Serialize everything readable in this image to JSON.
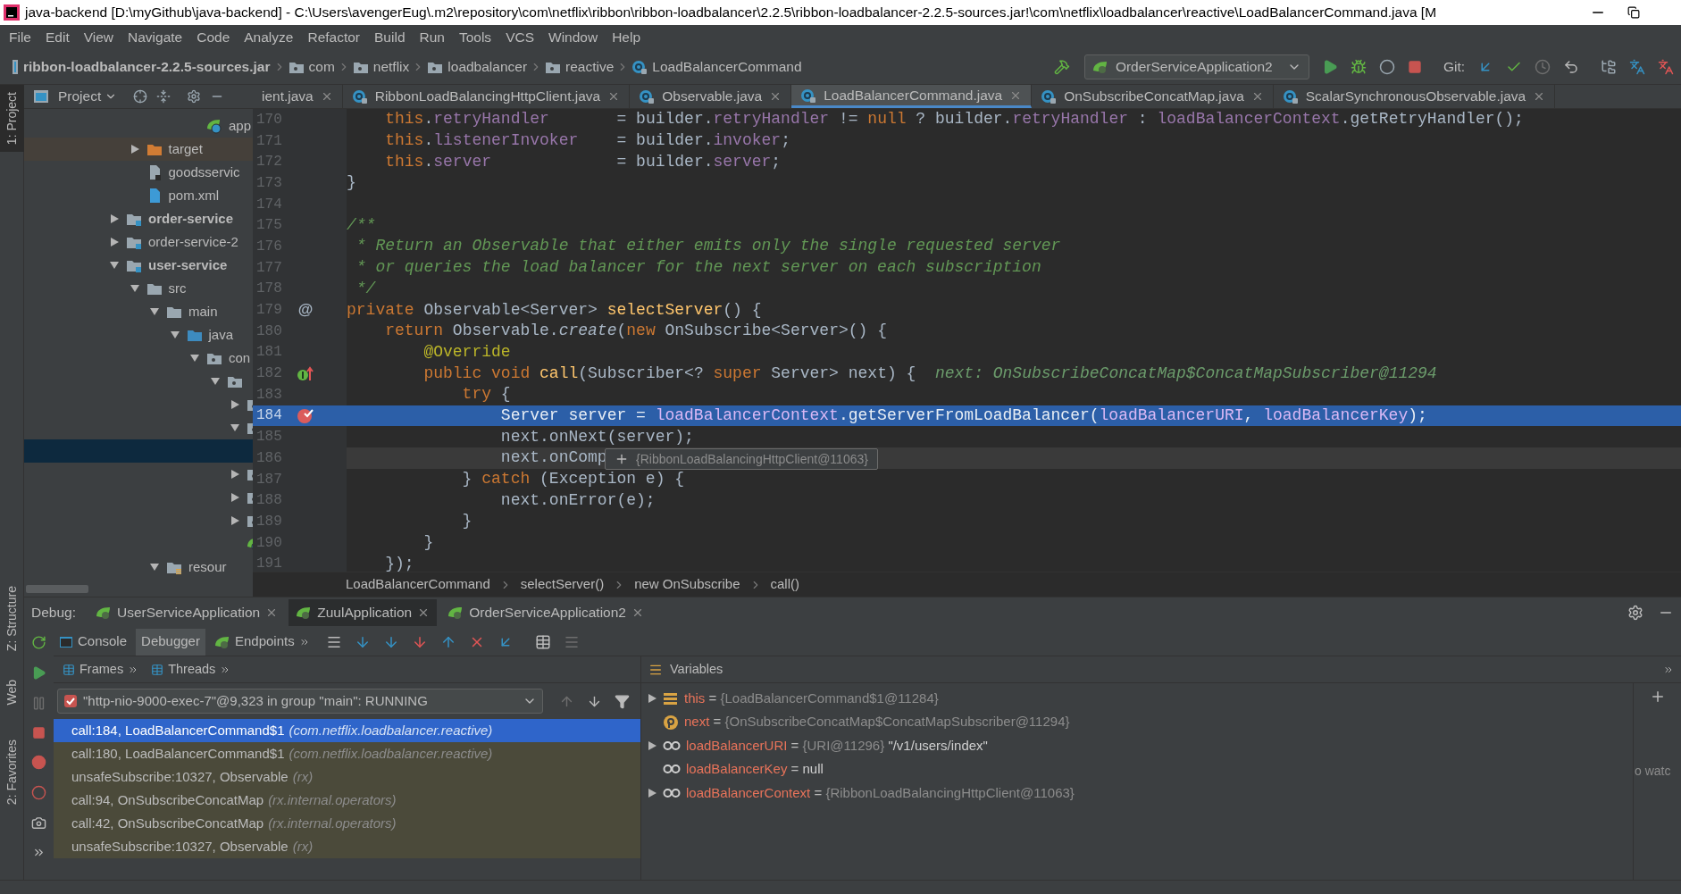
{
  "window": {
    "title": "java-backend [D:\\myGithub\\java-backend] - C:\\Users\\avengerEug\\.m2\\repository\\com\\netflix\\ribbon\\ribbon-loadbalancer\\2.2.5\\ribbon-loadbalancer-2.2.5-sources.jar!\\com\\netflix\\loadbalancer\\reactive\\LoadBalancerCommand.java [M"
  },
  "menu": [
    "File",
    "Edit",
    "View",
    "Navigate",
    "Code",
    "Analyze",
    "Refactor",
    "Build",
    "Run",
    "Tools",
    "VCS",
    "Window",
    "Help"
  ],
  "nav_bar": {
    "crumbs": [
      {
        "label": "ribbon-loadbalancer-2.2.5-sources.jar",
        "kind": "jar"
      },
      {
        "label": "com",
        "kind": "package"
      },
      {
        "label": "netflix",
        "kind": "package"
      },
      {
        "label": "loadbalancer",
        "kind": "package"
      },
      {
        "label": "reactive",
        "kind": "package"
      },
      {
        "label": "LoadBalancerCommand",
        "kind": "class"
      }
    ],
    "run_config": "OrderServiceApplication2",
    "git_label": "Git:"
  },
  "tool_strip": [
    {
      "label": "1: Project",
      "selected": true
    },
    {
      "label": "Z: Structure",
      "selected": false
    },
    {
      "label": "Web",
      "selected": false
    },
    {
      "label": "2: Favorites",
      "selected": false
    }
  ],
  "project_panel": {
    "title": "Project",
    "tree": [
      {
        "children": [
          {
            "children": [
              {
                "children": [
                  {
                    "children": [
                      {
                        "label": "app",
                        "kind": "spring",
                        "selected": false
                      }
                    ]
                  }
                ]
              }
            ]
          },
          {
            "label": "target",
            "kind": "excluded",
            "expanded": false,
            "selected": false
          },
          {
            "label": "goodsservic",
            "kind": "file",
            "selected": false
          },
          {
            "label": "pom.xml",
            "kind": "maven",
            "selected": false
          }
        ]
      },
      {
        "label": "order-service",
        "kind": "module",
        "expanded": false,
        "selected": false
      },
      {
        "label": "order-service-2",
        "kind": "plain-module",
        "expanded": false,
        "selected": false
      },
      {
        "label": "user-service",
        "kind": "module",
        "expanded": true,
        "selected": false,
        "children": [
          {
            "label": "src",
            "kind": "folder",
            "expanded": true,
            "selected": false,
            "children": [
              {
                "label": "main",
                "kind": "folder",
                "expanded": true,
                "selected": false,
                "children": [
                  {
                    "label": "java",
                    "kind": "source",
                    "expanded": true,
                    "selected": false,
                    "children": [
                      {
                        "label": "con",
                        "kind": "package",
                        "expanded": true,
                        "selected": false,
                        "children": [
                          {
                            "kind": "package",
                            "expanded": true,
                            "selected": false,
                            "children": [
                              {
                                "kind": "package",
                                "expanded": false,
                                "selected": false
                              },
                              {
                                "kind": "package",
                                "expanded": true,
                                "selected": false,
                                "children": [
                                  {
                                    "kind": "row",
                                    "selected": true
                                  }
                                ]
                              },
                              {
                                "kind": "package",
                                "expanded": false,
                                "selected": false
                              },
                              {
                                "kind": "package",
                                "expanded": false,
                                "selected": false
                              },
                              {
                                "kind": "package",
                                "expanded": false,
                                "selected": false
                              },
                              {
                                "kind": "spring",
                                "selected": false
                              }
                            ]
                          }
                        ]
                      }
                    ]
                  }
                ]
              },
              {
                "label": "resour",
                "kind": "resources",
                "expanded": true,
                "selected": false
              }
            ]
          }
        ]
      }
    ]
  },
  "editor": {
    "tabs": [
      {
        "label": "ient.java",
        "selected": false,
        "icon": false
      },
      {
        "label": "RibbonLoadBalancingHttpClient.java",
        "selected": false,
        "icon": true
      },
      {
        "label": "Observable.java",
        "selected": false,
        "icon": true
      },
      {
        "label": "LoadBalancerCommand.java",
        "selected": true,
        "icon": true
      },
      {
        "label": "OnSubscribeConcatMap.java",
        "selected": false,
        "icon": true
      },
      {
        "label": "ScalarSynchronousObservable.java",
        "selected": false,
        "icon": true
      }
    ],
    "lines": [
      {
        "number": "170",
        "selected": false,
        "current": false,
        "tokens": [
          {
            "kind": "keyword",
            "text": "    this"
          },
          {
            "kind": "plain",
            "text": "."
          },
          {
            "kind": "field",
            "text": "retryHandler"
          },
          {
            "kind": "plain",
            "text": "       = builder."
          },
          {
            "kind": "field",
            "text": "retryHandler"
          },
          {
            "kind": "plain",
            "text": " != "
          },
          {
            "kind": "keyword",
            "text": "null"
          },
          {
            "kind": "plain",
            "text": " ? builder."
          },
          {
            "kind": "field",
            "text": "retryHandler"
          },
          {
            "kind": "plain",
            "text": " : "
          },
          {
            "kind": "field",
            "text": "loadBalancerContext"
          },
          {
            "kind": "plain",
            "text": ".getRetryHandler();"
          }
        ]
      },
      {
        "number": "171",
        "selected": false,
        "current": false,
        "tokens": [
          {
            "kind": "keyword",
            "text": "    this"
          },
          {
            "kind": "plain",
            "text": "."
          },
          {
            "kind": "field",
            "text": "listenerInvoker"
          },
          {
            "kind": "plain",
            "text": "    = builder."
          },
          {
            "kind": "field",
            "text": "invoker"
          },
          {
            "kind": "plain",
            "text": ";"
          }
        ]
      },
      {
        "number": "172",
        "selected": false,
        "current": false,
        "tokens": [
          {
            "kind": "keyword",
            "text": "    this"
          },
          {
            "kind": "plain",
            "text": "."
          },
          {
            "kind": "field",
            "text": "server"
          },
          {
            "kind": "plain",
            "text": "             = builder."
          },
          {
            "kind": "field",
            "text": "server"
          },
          {
            "kind": "plain",
            "text": ";"
          }
        ]
      },
      {
        "number": "173",
        "selected": false,
        "current": false,
        "tokens": [
          {
            "kind": "plain",
            "text": "}"
          }
        ]
      },
      {
        "number": "174",
        "selected": false,
        "current": false
      },
      {
        "number": "175",
        "selected": false,
        "current": false,
        "tokens": [
          {
            "kind": "comment",
            "text": "/**"
          }
        ]
      },
      {
        "number": "176",
        "selected": false,
        "current": false,
        "tokens": [
          {
            "kind": "comment",
            "text": " * Return an Observable that either emits only the single requested server"
          }
        ]
      },
      {
        "number": "177",
        "selected": false,
        "current": false,
        "tokens": [
          {
            "kind": "comment",
            "text": " * or queries the load balancer for the next server on each subscription"
          }
        ]
      },
      {
        "number": "178",
        "selected": false,
        "current": false,
        "tokens": [
          {
            "kind": "comment",
            "text": " */"
          }
        ]
      },
      {
        "number": "179",
        "selected": false,
        "current": false,
        "gutter": {
          "kind": "text",
          "text": "@"
        },
        "tokens": [
          {
            "kind": "keyword",
            "text": "private "
          },
          {
            "kind": "plain",
            "text": "Observable<Server> "
          },
          {
            "kind": "method",
            "text": "selectServer"
          },
          {
            "kind": "plain",
            "text": "() {"
          }
        ]
      },
      {
        "number": "180",
        "selected": false,
        "current": false,
        "tokens": [
          {
            "kind": "keyword",
            "text": "    return "
          },
          {
            "kind": "plain",
            "text": "Observable."
          },
          {
            "kind": "static",
            "text": "create"
          },
          {
            "kind": "plain",
            "text": "("
          },
          {
            "kind": "keyword",
            "text": "new "
          },
          {
            "kind": "plain",
            "text": "OnSubscribe<Server>() {"
          }
        ]
      },
      {
        "number": "181",
        "selected": false,
        "current": false,
        "tokens": [
          {
            "kind": "annotation",
            "text": "        @Override"
          }
        ]
      },
      {
        "number": "182",
        "selected": false,
        "current": false,
        "gutter": {
          "kind": "implements"
        },
        "tokens": [
          {
            "kind": "keyword",
            "text": "        public void "
          },
          {
            "kind": "method",
            "text": "call"
          },
          {
            "kind": "plain",
            "text": "(Subscriber<? "
          },
          {
            "kind": "keyword",
            "text": "super "
          },
          {
            "kind": "plain",
            "text": "Server> next) {  "
          },
          {
            "kind": "hint",
            "text": "next: OnSubscribeConcatMap$ConcatMapSubscriber@11294"
          }
        ]
      },
      {
        "number": "183",
        "selected": false,
        "current": false,
        "tokens": [
          {
            "kind": "keyword",
            "text": "            try "
          },
          {
            "kind": "plain",
            "text": "{"
          }
        ]
      },
      {
        "number": "184",
        "selected": true,
        "current": false,
        "gutter": {
          "kind": "breakpoint"
        },
        "tokens": [
          {
            "kind": "plain",
            "text": "                Server server = "
          },
          {
            "kind": "field",
            "text": "loadBalancerContext"
          },
          {
            "kind": "plain",
            "text": ".getServerFromLoadBalancer("
          },
          {
            "kind": "field",
            "text": "loadBalancerURI"
          },
          {
            "kind": "plain",
            "text": ", "
          },
          {
            "kind": "field",
            "text": "loadBalancerKey"
          },
          {
            "kind": "plain",
            "text": ");"
          }
        ]
      },
      {
        "number": "185",
        "selected": false,
        "current": false,
        "tokens": [
          {
            "kind": "plain",
            "text": "                next.onNext(server);"
          }
        ]
      },
      {
        "number": "186",
        "selected": false,
        "current": true,
        "tokens": [
          {
            "kind": "plain",
            "text": "                next.onComp"
          }
        ]
      },
      {
        "number": "187",
        "selected": false,
        "current": false,
        "tokens": [
          {
            "kind": "plain",
            "text": "            } "
          },
          {
            "kind": "keyword",
            "text": "catch "
          },
          {
            "kind": "plain",
            "text": "(Exception e) {"
          }
        ]
      },
      {
        "number": "188",
        "selected": false,
        "current": false,
        "tokens": [
          {
            "kind": "plain",
            "text": "                next.onError(e);"
          }
        ]
      },
      {
        "number": "189",
        "selected": false,
        "current": false,
        "tokens": [
          {
            "kind": "plain",
            "text": "            }"
          }
        ]
      },
      {
        "number": "190",
        "selected": false,
        "current": false,
        "tokens": [
          {
            "kind": "plain",
            "text": "        }"
          }
        ]
      },
      {
        "number": "191",
        "selected": false,
        "current": false,
        "tokens": [
          {
            "kind": "plain",
            "text": "    });"
          }
        ]
      }
    ],
    "tooltip": "{RibbonLoadBalancingHttpClient@11063}",
    "breadcrumbs": [
      "LoadBalancerCommand",
      "selectServer()",
      "new OnSubscribe",
      "call()"
    ]
  },
  "debug": {
    "label": "Debug:",
    "sessions": [
      {
        "label": "UserServiceApplication",
        "selected": false
      },
      {
        "label": "ZuulApplication",
        "selected": true
      },
      {
        "label": "OrderServiceApplication2",
        "selected": false
      }
    ],
    "tabs": [
      {
        "label": "Console",
        "selected": false
      },
      {
        "label": "Debugger",
        "selected": true
      },
      {
        "label": "Endpoints",
        "selected": false
      }
    ],
    "frame_tabs": [
      {
        "label": "Frames",
        "selected": false
      },
      {
        "label": "Threads",
        "selected": false
      }
    ],
    "thread": "\"http-nio-9000-exec-7\"@9,323 in group \"main\": RUNNING",
    "frames": [
      {
        "method": "call:184, LoadBalancerCommand$1",
        "package": "(com.netflix.loadbalancer.reactive)",
        "selected": true
      },
      {
        "method": "call:180, LoadBalancerCommand$1",
        "package": "(com.netflix.loadbalancer.reactive)",
        "selected": false
      },
      {
        "method": "unsafeSubscribe:10327, Observable",
        "package": "(rx)",
        "selected": false
      },
      {
        "method": "call:94, OnSubscribeConcatMap",
        "package": "(rx.internal.operators)",
        "selected": false
      },
      {
        "method": "call:42, OnSubscribeConcatMap",
        "package": "(rx.internal.operators)",
        "selected": false
      },
      {
        "method": "unsafeSubscribe:10327, Observable",
        "package": "(rx)",
        "selected": false
      }
    ],
    "variables_title": "Variables",
    "variables": [
      {
        "kind": "field",
        "name": "this",
        "sign": "=",
        "ref": "{LoadBalancerCommand$1@11284}",
        "expandable": true
      },
      {
        "kind": "param",
        "name": "next",
        "sign": "=",
        "ref": "{OnSubscribeConcatMap$ConcatMapSubscriber@11294}",
        "expandable": false
      },
      {
        "kind": "watch",
        "name": "loadBalancerURI",
        "sign": "=",
        "ref": "{URI@11296}",
        "value": "\"/v1/users/index\"",
        "expandable": true
      },
      {
        "kind": "watch",
        "name": "loadBalancerKey",
        "sign": "=",
        "value": "null",
        "expandable": false
      },
      {
        "kind": "watch",
        "name": "loadBalancerContext",
        "sign": "=",
        "ref": "{RibbonLoadBalancingHttpClient@11063}",
        "expandable": true
      }
    ],
    "watches_hint": "o watc"
  }
}
